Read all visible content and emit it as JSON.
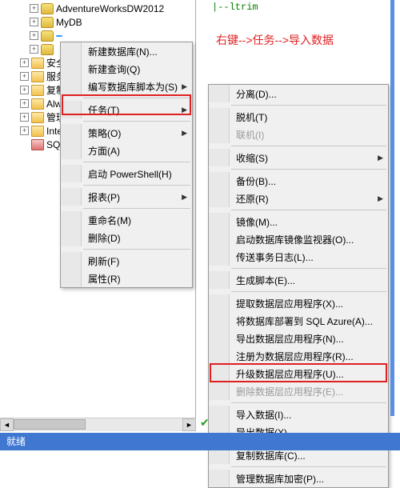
{
  "annotation": "右键-->任务-->导入数据",
  "code_hint": "|--ltrim",
  "tree": {
    "items": [
      "AdventureWorksDW2012",
      "MyDB",
      "",
      "",
      "安全",
      "服务",
      "复制",
      "Alwa",
      "管理",
      "Inte",
      "SQL"
    ],
    "selected_placeholder": "        "
  },
  "menu1": [
    {
      "label": "新建数据库(N)...",
      "arrow": false
    },
    {
      "label": "新建查询(Q)",
      "arrow": false
    },
    {
      "label": "编写数据库脚本为(S)",
      "arrow": true
    },
    {
      "sep": true
    },
    {
      "label": "任务(T)",
      "arrow": true,
      "active": true
    },
    {
      "sep": true
    },
    {
      "label": "策略(O)",
      "arrow": true
    },
    {
      "label": "方面(A)",
      "arrow": false
    },
    {
      "sep": true
    },
    {
      "label": "启动 PowerShell(H)",
      "arrow": false
    },
    {
      "sep": true
    },
    {
      "label": "报表(P)",
      "arrow": true
    },
    {
      "sep": true
    },
    {
      "label": "重命名(M)",
      "arrow": false
    },
    {
      "label": "删除(D)",
      "arrow": false
    },
    {
      "sep": true
    },
    {
      "label": "刷新(F)",
      "arrow": false
    },
    {
      "label": "属性(R)",
      "arrow": false
    }
  ],
  "menu2": [
    {
      "label": "分离(D)...",
      "arrow": false
    },
    {
      "sep": true
    },
    {
      "label": "脱机(T)",
      "arrow": false
    },
    {
      "label": "联机(I)",
      "arrow": false,
      "disabled": true
    },
    {
      "sep": true
    },
    {
      "label": "收缩(S)",
      "arrow": true
    },
    {
      "sep": true
    },
    {
      "label": "备份(B)...",
      "arrow": false
    },
    {
      "label": "还原(R)",
      "arrow": true
    },
    {
      "sep": true
    },
    {
      "label": "镜像(M)...",
      "arrow": false
    },
    {
      "label": "启动数据库镜像监视器(O)...",
      "arrow": false
    },
    {
      "label": "传送事务日志(L)...",
      "arrow": false
    },
    {
      "sep": true
    },
    {
      "label": "生成脚本(E)...",
      "arrow": false
    },
    {
      "sep": true
    },
    {
      "label": "提取数据层应用程序(X)...",
      "arrow": false
    },
    {
      "label": "将数据库部署到 SQL Azure(A)...",
      "arrow": false
    },
    {
      "label": "导出数据层应用程序(N)...",
      "arrow": false
    },
    {
      "label": "注册为数据层应用程序(R)...",
      "arrow": false
    },
    {
      "label": "升级数据层应用程序(U)...",
      "arrow": false
    },
    {
      "label": "删除数据层应用程序(E)...",
      "arrow": false,
      "disabled": true
    },
    {
      "sep": true
    },
    {
      "label": "导入数据(I)...",
      "arrow": false,
      "active": true
    },
    {
      "label": "导出数据(X)...",
      "arrow": false
    },
    {
      "sep": true
    },
    {
      "label": "复制数据库(C)...",
      "arrow": false
    },
    {
      "sep": true
    },
    {
      "label": "管理数据库加密(P)...",
      "arrow": false
    }
  ],
  "status": "就绪"
}
